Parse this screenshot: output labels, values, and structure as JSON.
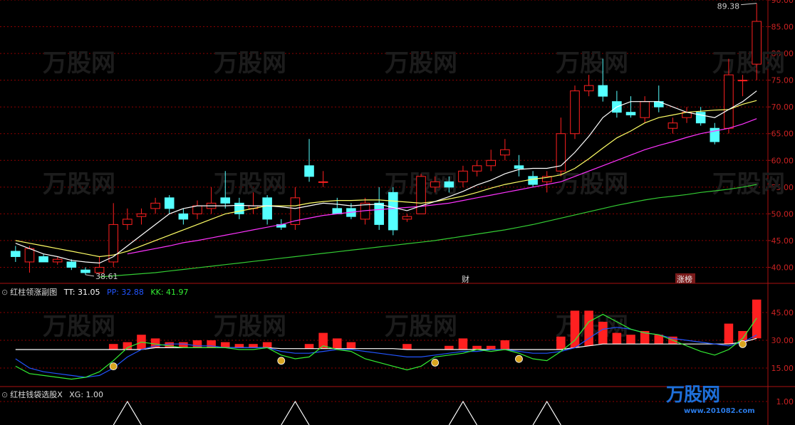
{
  "main_panel": {
    "y_ticks": [
      "90.00",
      "85.00",
      "80.00",
      "75.00",
      "70.00",
      "65.00",
      "60.00",
      "55.00",
      "50.00",
      "45.00",
      "40.00"
    ],
    "high_label": "89.38",
    "low_label": "38.61",
    "markers": {
      "cai": "财",
      "zhangbang": "涨榜"
    }
  },
  "sub1": {
    "title": "红柱领涨副图",
    "tt_label": "TT: 31.05",
    "pp_label": "PP: 32.88",
    "kk_label": "KK: 41.97",
    "y_ticks": [
      "45.00",
      "30.00",
      "15.00"
    ]
  },
  "sub2": {
    "title": "红柱钱袋选股X",
    "xg_label": "XG: 1.00",
    "y_ticks": [
      "1.00"
    ]
  },
  "watermark": {
    "brand": "万股网",
    "url": "www.201082.com"
  },
  "colors": {
    "up": "#ff2020",
    "down": "#55ffff",
    "ma5": "#ffffff",
    "ma10": "#ffff66",
    "ma20": "#ff33ff",
    "ma60": "#33cc33",
    "tt": "#ffffff",
    "pp": "#2255ff",
    "kk": "#33ee33",
    "grid": "#8b0000"
  },
  "chart_data": {
    "type": "candlestick",
    "ylim": [
      37,
      90
    ],
    "candles": [
      [
        43,
        42,
        44,
        41
      ],
      [
        41,
        43.5,
        44,
        39
      ],
      [
        42,
        41,
        42.5,
        41
      ],
      [
        41,
        41.5,
        42,
        40.5
      ],
      [
        41,
        40,
        41.5,
        39.5
      ],
      [
        39.5,
        39,
        40,
        38.6
      ],
      [
        39,
        40,
        42,
        38.7
      ],
      [
        41,
        48,
        52,
        40
      ],
      [
        48,
        49,
        51,
        47
      ],
      [
        49.5,
        50,
        51,
        48
      ],
      [
        51,
        52,
        53,
        50
      ],
      [
        53,
        51,
        53.5,
        50
      ],
      [
        50,
        49,
        51,
        48
      ],
      [
        50,
        51.5,
        52.5,
        49
      ],
      [
        51,
        52,
        55,
        50
      ],
      [
        53,
        52,
        58,
        51
      ],
      [
        52,
        50,
        53,
        49
      ],
      [
        51,
        51.5,
        54,
        50
      ],
      [
        53,
        49,
        53.5,
        48
      ],
      [
        48,
        47.5,
        49,
        47
      ],
      [
        48,
        53,
        55,
        47
      ],
      [
        59,
        57,
        64,
        56
      ],
      [
        56,
        56,
        58,
        55
      ],
      [
        51,
        50,
        53,
        50
      ],
      [
        51,
        49.5,
        52,
        49
      ],
      [
        49,
        52,
        53,
        48
      ],
      [
        52,
        48,
        55,
        47
      ],
      [
        54,
        47,
        55,
        46
      ],
      [
        49,
        49.5,
        50,
        48.5
      ],
      [
        50,
        57,
        57.5,
        50
      ],
      [
        55,
        56,
        57,
        54
      ],
      [
        56,
        55,
        57,
        54
      ],
      [
        56,
        58,
        59,
        55
      ],
      [
        58,
        59,
        60,
        57
      ],
      [
        59,
        60,
        62,
        58
      ],
      [
        61,
        62,
        64,
        60
      ],
      [
        59,
        58.5,
        61,
        57
      ],
      [
        57,
        55.5,
        58,
        55
      ],
      [
        56,
        57,
        58,
        54
      ],
      [
        58,
        65,
        68,
        57
      ],
      [
        65,
        73,
        74,
        64
      ],
      [
        73,
        74,
        76,
        72
      ],
      [
        74,
        72,
        79,
        71
      ],
      [
        71,
        69,
        73,
        68
      ],
      [
        69,
        68.5,
        72,
        68
      ],
      [
        68,
        71,
        72,
        67
      ],
      [
        71,
        70,
        74,
        69
      ],
      [
        66,
        67,
        68,
        65
      ],
      [
        68,
        69,
        70,
        67
      ],
      [
        69,
        67,
        70,
        66.5
      ],
      [
        66,
        63.5,
        67,
        63
      ],
      [
        66,
        76,
        79,
        65
      ],
      [
        75,
        75,
        76,
        72
      ],
      [
        78,
        86,
        89.38,
        75
      ]
    ],
    "ma5": [
      44.5,
      43.5,
      42.5,
      42,
      41.3,
      41,
      40.8,
      42,
      44,
      46,
      48,
      50,
      51,
      51.5,
      51.5,
      51.5,
      51.6,
      51.5,
      51.5,
      51.3,
      51,
      51.5,
      52,
      51.8,
      51.5,
      51.7,
      51.8,
      51.2,
      50.6,
      51.5,
      52.3,
      53.2,
      54.2,
      55.4,
      56.3,
      57.5,
      58.3,
      58.5,
      58.5,
      59,
      61.5,
      64.5,
      68,
      70,
      71,
      71,
      71,
      70,
      69,
      68.5,
      68,
      69.5,
      71,
      73
    ],
    "ma10": [
      45,
      44.5,
      44,
      43.5,
      43,
      42.5,
      42,
      42.3,
      43,
      44,
      45,
      46,
      47,
      48,
      49,
      50,
      50.5,
      51,
      51.5,
      51.5,
      51.5,
      52,
      52.3,
      52.5,
      52.5,
      52.6,
      52.6,
      52.4,
      52.2,
      52,
      52.3,
      52.8,
      53.3,
      54,
      54.8,
      55.5,
      56,
      56.5,
      56.8,
      57.3,
      58.5,
      60.3,
      62.3,
      64.2,
      65.5,
      67,
      68,
      68.5,
      69,
      69.2,
      69.4,
      69.5,
      70.5,
      71.2
    ],
    "ma20": [
      null,
      null,
      null,
      null,
      null,
      null,
      null,
      null,
      42.5,
      43,
      43.5,
      44,
      44.6,
      45,
      45.5,
      46,
      46.5,
      47,
      47.5,
      48,
      48.7,
      49.2,
      49.7,
      50,
      50.3,
      50.6,
      50.8,
      51,
      51.2,
      51.4,
      51.7,
      52,
      52.5,
      53,
      53.5,
      54,
      54.5,
      55,
      55.5,
      56,
      57,
      58,
      59,
      60,
      61,
      62,
      62.8,
      63.5,
      64.3,
      65,
      65.5,
      66,
      66.8,
      67.8
    ],
    "ma60": [
      null,
      null,
      null,
      null,
      null,
      null,
      38.2,
      38.4,
      38.6,
      38.8,
      39,
      39.3,
      39.6,
      39.9,
      40.2,
      40.5,
      40.8,
      41.1,
      41.4,
      41.7,
      42,
      42.3,
      42.6,
      42.9,
      43.2,
      43.5,
      43.8,
      44.1,
      44.4,
      44.7,
      45,
      45.4,
      45.8,
      46.2,
      46.6,
      47,
      47.5,
      48,
      48.6,
      49.2,
      49.8,
      50.4,
      51,
      51.6,
      52.1,
      52.6,
      53,
      53.3,
      53.6,
      54,
      54.3,
      54.6,
      55,
      55.5
    ],
    "sub_red_bars": [
      null,
      null,
      null,
      null,
      null,
      null,
      null,
      28,
      29,
      33,
      31,
      29,
      29,
      30,
      30,
      29,
      28,
      28,
      29,
      null,
      null,
      28,
      34,
      31,
      29,
      null,
      null,
      null,
      28,
      null,
      null,
      27,
      31,
      27,
      27,
      30,
      null,
      null,
      null,
      32,
      46,
      46,
      40,
      34,
      33,
      35,
      33,
      32,
      null,
      null,
      null,
      39,
      35,
      52
    ],
    "tt": [
      25,
      25,
      25,
      25,
      25,
      25,
      25,
      25,
      25,
      25,
      26,
      26,
      26,
      26,
      26,
      26,
      26,
      26,
      26,
      25.5,
      25.5,
      25.5,
      25.5,
      25.5,
      25.5,
      25.5,
      25.5,
      25.5,
      25,
      25,
      25,
      25,
      25,
      25,
      25,
      25,
      25,
      25,
      25,
      25,
      26,
      27,
      28,
      28,
      28,
      28,
      28,
      28,
      28,
      28,
      28,
      28,
      29,
      31.05
    ],
    "pp": [
      20,
      15,
      13,
      12,
      11,
      10,
      11,
      15,
      21,
      25,
      27,
      28,
      28,
      27,
      27,
      26,
      26,
      26,
      26,
      24,
      23,
      23,
      24,
      25,
      25,
      24,
      23,
      22,
      21,
      21,
      22,
      23,
      24,
      24,
      25,
      25,
      24,
      23,
      23,
      24,
      26,
      31,
      36,
      37,
      36,
      34,
      33,
      31,
      30,
      29,
      28,
      27,
      29,
      32.88
    ],
    "kk": [
      16,
      12,
      11,
      10,
      9,
      10,
      13,
      19,
      26,
      29,
      28,
      27,
      26,
      26,
      26,
      26,
      25,
      25,
      26,
      22,
      20,
      21,
      27,
      25,
      24,
      20,
      18,
      16,
      14,
      16,
      21,
      22,
      23,
      25,
      24,
      25,
      23,
      20,
      19,
      24,
      30,
      40,
      44,
      40,
      36,
      34,
      33,
      30,
      27,
      24,
      22,
      25,
      31,
      41.97
    ],
    "sub_signal_idx": [
      7,
      19,
      30,
      36,
      52
    ],
    "xg_peaks": [
      8,
      20,
      32,
      38
    ]
  }
}
